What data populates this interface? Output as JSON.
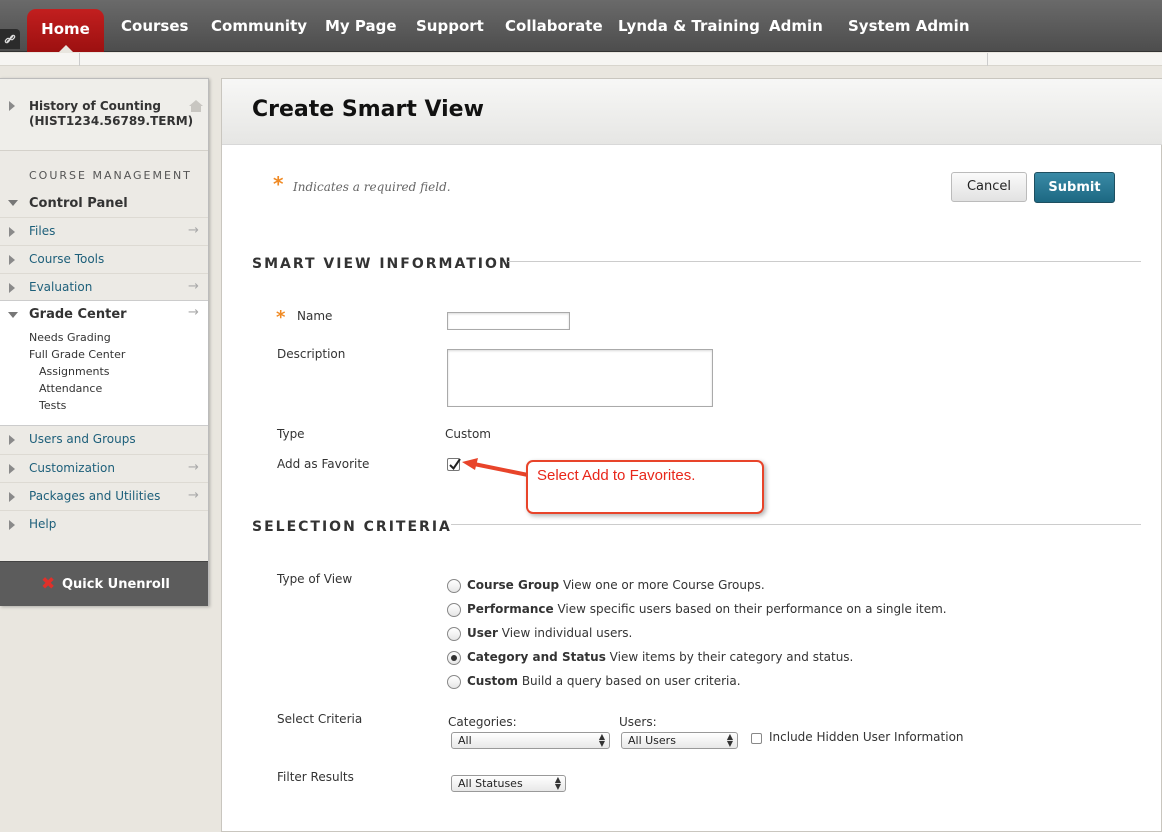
{
  "nav": {
    "tabs": [
      "Home",
      "Courses",
      "Community",
      "My Page",
      "Support",
      "Collaborate",
      "Lynda & Training",
      "Admin",
      "System Admin"
    ],
    "active_tab": "Home"
  },
  "course": {
    "title": "History of Counting (HIST1234.56789.TERM)"
  },
  "sidebar": {
    "section_label": "COURSE MANAGEMENT",
    "control_panel": "Control Panel",
    "items_top": [
      "Files",
      "Course Tools",
      "Evaluation"
    ],
    "grade_center": {
      "label": "Grade Center",
      "children": [
        "Needs Grading",
        "Full Grade Center",
        "Assignments",
        "Attendance",
        "Tests"
      ]
    },
    "items_bottom": [
      "Users and Groups",
      "Customization",
      "Packages and Utilities",
      "Help"
    ],
    "quick_unenroll": "Quick Unenroll"
  },
  "page": {
    "title": "Create Smart View",
    "required_note": "Indicates a required field.",
    "cancel_label": "Cancel",
    "submit_label": "Submit"
  },
  "smart_view_info": {
    "section_title": "SMART VIEW INFORMATION",
    "name_label": "Name",
    "name_value": "",
    "description_label": "Description",
    "description_value": "",
    "type_label": "Type",
    "type_value": "Custom",
    "favorite_label": "Add as Favorite",
    "favorite_checked": true
  },
  "callout": {
    "text": "Select Add to Favorites.",
    "color": "#e8442a"
  },
  "selection_criteria": {
    "section_title": "SELECTION CRITERIA",
    "type_of_view_label": "Type of View",
    "options": [
      {
        "title": "Course Group",
        "desc": "View one or more Course Groups.",
        "checked": false
      },
      {
        "title": "Performance",
        "desc": "View specific users based on their performance on a single item.",
        "checked": false
      },
      {
        "title": "User",
        "desc": "View individual users.",
        "checked": false
      },
      {
        "title": "Category and Status",
        "desc": "View items by their category and status.",
        "checked": true
      },
      {
        "title": "Custom",
        "desc": "Build a query based on user criteria.",
        "checked": false
      }
    ],
    "select_criteria_label": "Select Criteria",
    "categories_label": "Categories:",
    "categories_value": "All",
    "users_label": "Users:",
    "users_value": "All Users",
    "include_hidden_label": "Include Hidden User Information",
    "filter_results_label": "Filter Results",
    "filter_value": "All Statuses"
  },
  "colors": {
    "home_tab": "#b01818",
    "nav_bg": "#5a5a5a",
    "submit": "#2a7893",
    "required": "#f08a24",
    "link": "#1d5f7a"
  }
}
